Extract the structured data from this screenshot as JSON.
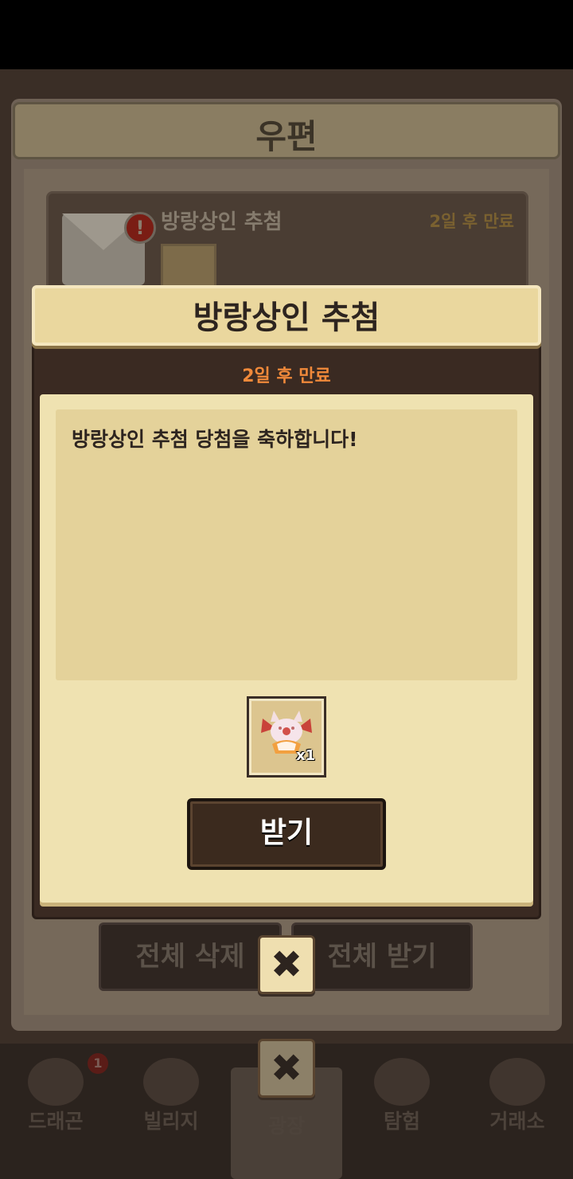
{
  "background": {
    "mailbox_title": "우편",
    "mail_item": {
      "title": "방랑상인 추첨",
      "expire": "2일 후 만료",
      "alert_icon": "!"
    },
    "delete_all_label": "전체 삭제",
    "receive_all_label": "전체 받기",
    "close_icon_glyph": "✖"
  },
  "bottom_nav": {
    "items": [
      {
        "label": "드래곤",
        "badge": "1"
      },
      {
        "label": "빌리지"
      },
      {
        "label": "광장"
      },
      {
        "label": "탐험"
      },
      {
        "label": "거래소"
      }
    ]
  },
  "popup": {
    "title": "방랑상인 추첨",
    "expire": "2일 후 만료",
    "message": "방랑상인 추첨 당첨을 축하합니다!",
    "reward": {
      "icon": "dragon-egg-icon",
      "quantity": "x1"
    },
    "receive_label": "받기",
    "close_icon_glyph": "✖"
  },
  "colors": {
    "header_gold": "#ead79e",
    "frame_brown": "#3a2a22",
    "expire_orange": "#f0893a",
    "panel_cream": "#efe2b1"
  }
}
